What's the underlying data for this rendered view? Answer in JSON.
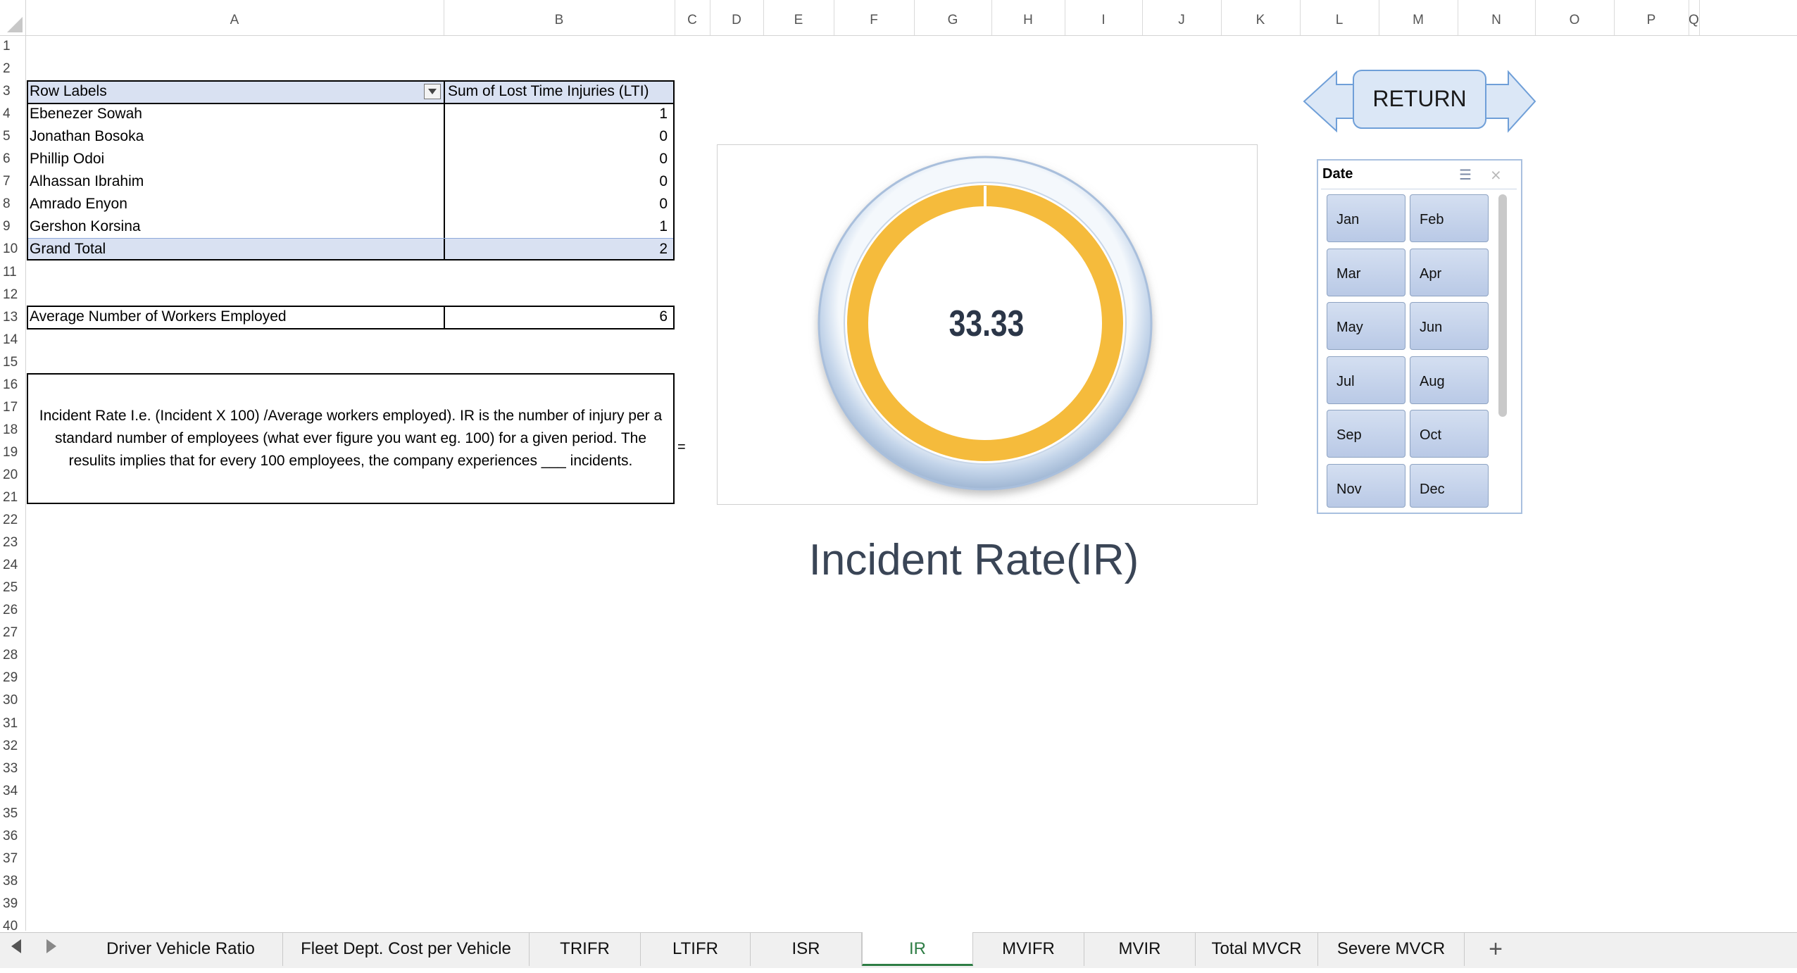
{
  "columns": [
    "A",
    "B",
    "C",
    "D",
    "E",
    "F",
    "G",
    "H",
    "I",
    "J",
    "K",
    "L",
    "M",
    "N",
    "O",
    "P",
    "Q"
  ],
  "rows": [
    "1",
    "2",
    "3",
    "4",
    "5",
    "6",
    "7",
    "8",
    "9",
    "10",
    "11",
    "12",
    "13",
    "14",
    "15",
    "16",
    "17",
    "18",
    "19",
    "20",
    "21",
    "22",
    "23",
    "24",
    "25",
    "26",
    "27",
    "28",
    "29",
    "30",
    "31",
    "32",
    "33",
    "34",
    "35",
    "36",
    "37",
    "38",
    "39",
    "40"
  ],
  "pivot": {
    "header_label": "Row Labels",
    "header_value": "Sum of Lost Time Injuries  (LTI)",
    "rows": [
      {
        "name": "Ebenezer Sowah",
        "value": "1"
      },
      {
        "name": "Jonathan Bosoka",
        "value": "0"
      },
      {
        "name": "Phillip Odoi",
        "value": "0"
      },
      {
        "name": "Alhassan Ibrahim",
        "value": "0"
      },
      {
        "name": "Amrado Enyon",
        "value": "0"
      },
      {
        "name": "Gershon Korsina",
        "value": "1"
      }
    ],
    "total_label": "Grand Total",
    "total_value": "2"
  },
  "workers": {
    "label": "Average Number of Workers Employed",
    "value": "6"
  },
  "note": {
    "text": "Incident Rate I.e. (Incident X 100) /Average workers employed). IR is the number of injury per a standard number of employees (what ever figure you want eg. 100) for a given period. The resulits implies that for every 100 employees, the company experiences ___ incidents.",
    "trailing": "="
  },
  "gauge": {
    "value": "33.33",
    "fraction": 1.0,
    "ring_color": "#f5bb3c"
  },
  "chart_title": "Incident Rate(IR)",
  "return_button": "RETURN",
  "slicer": {
    "title": "Date",
    "items": [
      "Jan",
      "Feb",
      "Mar",
      "Apr",
      "May",
      "Jun",
      "Jul",
      "Aug",
      "Sep",
      "Oct",
      "Nov",
      "Dec"
    ]
  },
  "tabs": [
    "Driver Vehicle Ratio",
    "Fleet Dept. Cost per Vehicle",
    "TRIFR",
    "LTIFR",
    "ISR",
    "IR",
    "MVIFR",
    "MVIR",
    "Total MVCR",
    "Severe MVCR"
  ],
  "active_tab": "IR",
  "add_sheet": "+"
}
